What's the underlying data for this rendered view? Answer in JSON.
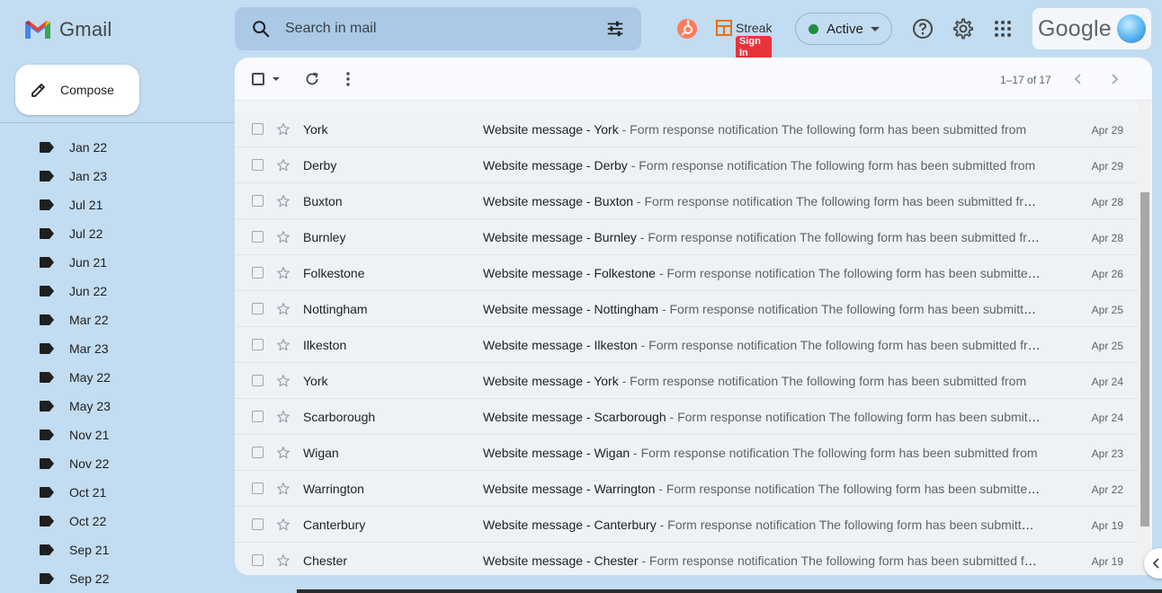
{
  "app": {
    "name": "Gmail",
    "colors": {
      "red": "#EA4335",
      "blue": "#4285F4",
      "green": "#34A853",
      "yellow": "#FBBC04"
    }
  },
  "search": {
    "placeholder": "Search in mail"
  },
  "header": {
    "streak_label": "Streak",
    "streak_signin": "Sign In",
    "status_label": "Active",
    "account_brand": "Google"
  },
  "compose": {
    "label": "Compose"
  },
  "sidebar": {
    "items": [
      {
        "label": "Jan 22"
      },
      {
        "label": "Jan 23"
      },
      {
        "label": "Jul 21"
      },
      {
        "label": "Jul 22"
      },
      {
        "label": "Jun 21"
      },
      {
        "label": "Jun 22"
      },
      {
        "label": "Mar 22"
      },
      {
        "label": "Mar 23"
      },
      {
        "label": "May 22"
      },
      {
        "label": "May 23"
      },
      {
        "label": "Nov 21"
      },
      {
        "label": "Nov 22"
      },
      {
        "label": "Oct 21"
      },
      {
        "label": "Oct 22"
      },
      {
        "label": "Sep 21"
      },
      {
        "label": "Sep 22"
      }
    ]
  },
  "toolbar": {
    "range": "1–17 of 17"
  },
  "emails": [
    {
      "sender": "York",
      "subject": "Website message - York",
      "snippet": " - Form response notification The following form has been submitted from",
      "date": "Apr 29"
    },
    {
      "sender": "Derby",
      "subject": "Website message - Derby",
      "snippet": " - Form response notification The following form has been submitted from",
      "date": "Apr 29"
    },
    {
      "sender": "Buxton",
      "subject": "Website message - Buxton",
      "snippet": " - Form response notification The following form has been submitted from",
      "date": "Apr 28"
    },
    {
      "sender": "Burnley",
      "subject": "Website message - Burnley",
      "snippet": " - Form response notification The following form has been submitted from",
      "date": "Apr 28"
    },
    {
      "sender": "Folkestone",
      "subject": "Website message - Folkestone",
      "snippet": " - Form response notification The following form has been submitted from",
      "date": "Apr 26"
    },
    {
      "sender": "Nottingham",
      "subject": "Website message - Nottingham",
      "snippet": " - Form response notification The following form has been submitted from",
      "date": "Apr 25"
    },
    {
      "sender": "Ilkeston",
      "subject": "Website message - Ilkeston",
      "snippet": " - Form response notification The following form has been submitted from",
      "date": "Apr 25"
    },
    {
      "sender": "York",
      "subject": "Website message - York",
      "snippet": " - Form response notification The following form has been submitted from",
      "date": "Apr 24"
    },
    {
      "sender": "Scarborough",
      "subject": "Website message - Scarborough",
      "snippet": " - Form response notification The following form has been submitted from",
      "date": "Apr 24"
    },
    {
      "sender": "Wigan",
      "subject": "Website message - Wigan",
      "snippet": " - Form response notification The following form has been submitted from",
      "date": "Apr 23"
    },
    {
      "sender": "Warrington",
      "subject": "Website message - Warrington",
      "snippet": " - Form response notification The following form has been submitted from",
      "date": "Apr 22"
    },
    {
      "sender": "Canterbury",
      "subject": "Website message - Canterbury",
      "snippet": " - Form response notification The following form has been submitted from",
      "date": "Apr 19"
    },
    {
      "sender": "Chester",
      "subject": "Website message - Chester",
      "snippet": " - Form response notification The following form has been submitted from",
      "date": "Apr 19"
    }
  ]
}
